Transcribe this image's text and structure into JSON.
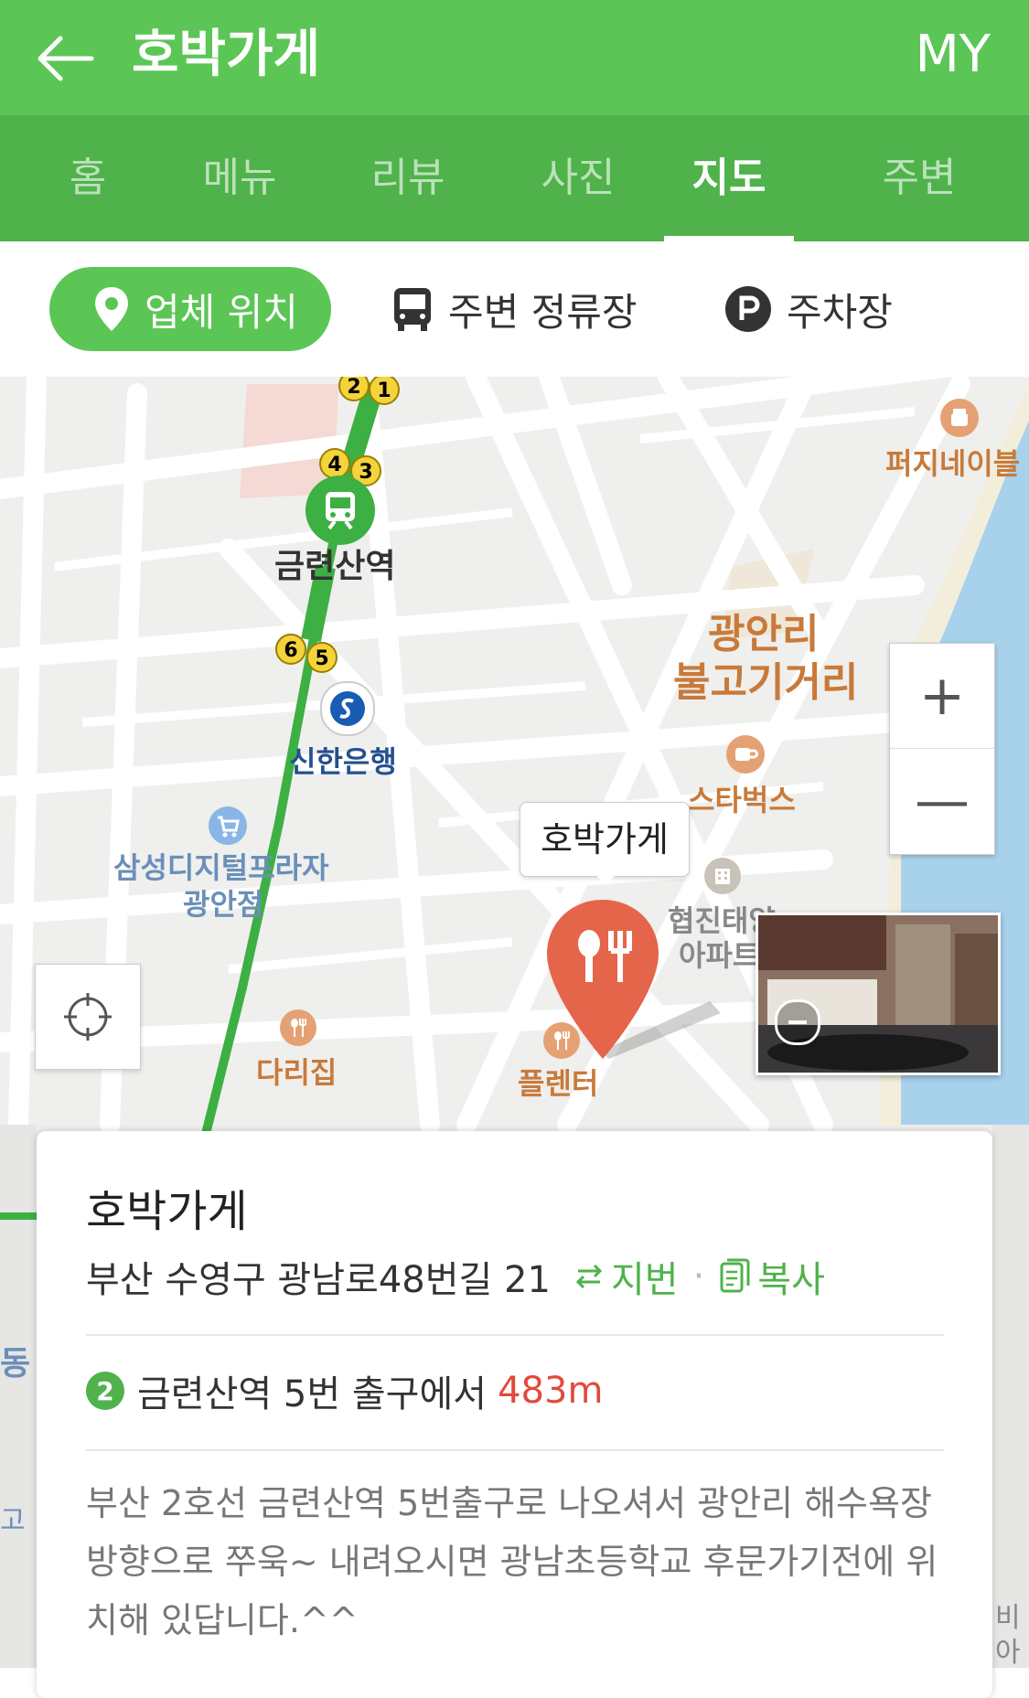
{
  "header": {
    "title": "호박가게",
    "my_label": "MY",
    "back_icon": "arrow-left-icon"
  },
  "tabs": [
    {
      "label": "홈",
      "active": false
    },
    {
      "label": "메뉴",
      "active": false
    },
    {
      "label": "리뷰",
      "active": false
    },
    {
      "label": "사진",
      "active": false
    },
    {
      "label": "지도",
      "active": true
    },
    {
      "label": "주변",
      "active": false
    }
  ],
  "filters": [
    {
      "label": "업체 위치",
      "icon": "map-pin-icon",
      "active": true
    },
    {
      "label": "주변 정류장",
      "icon": "bus-icon",
      "active": false
    },
    {
      "label": "주차장",
      "icon": "parking-icon",
      "active": false
    }
  ],
  "map": {
    "labels": {
      "station": "금련산역",
      "bank": "신한은행",
      "electronics_1": "삼성디지털프라자",
      "electronics_2": "광안점",
      "street_1": "광안리",
      "street_2": "불고기거리",
      "starbucks": "스타벅스",
      "apartment_1": "협진태양",
      "apartment_2": "아파트",
      "restaurant_1": "다리집",
      "restaurant_2": "플렌터",
      "cafe": "퍼지네이블",
      "edge_1": "동",
      "edge_2": "고",
      "edge_3": "비",
      "edge_4": "아"
    },
    "exits": [
      "1",
      "2",
      "3",
      "4",
      "5",
      "6"
    ],
    "marker_tooltip": "호박가게",
    "zoom_in": "+",
    "zoom_out": "—"
  },
  "place": {
    "name": "호박가게",
    "address": "부산 수영구 광남로48번길 21",
    "jibun_label": "지번",
    "dot": "·",
    "copy_label": "복사",
    "subway_line": "2",
    "subway_text": "금련산역 5번 출구에서",
    "subway_distance": "483m",
    "description": "부산 2호선 금련산역 5번출구로 나오셔서 광안리 해수욕장 방향으로 쭈욱~ 내려오시면 광남초등학교 후문가기전에 위치해 있답니다.^^"
  },
  "colors": {
    "brand_green": "#5bc655",
    "tab_green": "#4fb24b",
    "marker_red": "#e5654a",
    "distance_red": "#e14a3d"
  }
}
